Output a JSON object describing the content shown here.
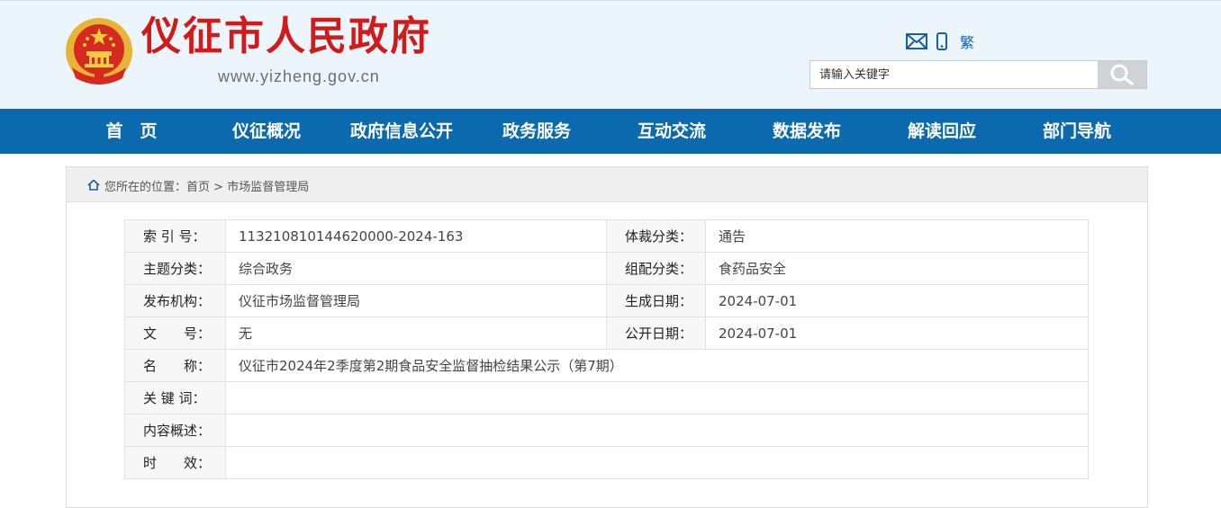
{
  "header": {
    "site_title": "仪征市人民政府",
    "site_url": "www.yizheng.gov.cn",
    "traditional_label": "繁",
    "search_placeholder": "请输入关键字"
  },
  "nav": {
    "items": [
      "首　页",
      "仪征概况",
      "政府信息公开",
      "政务服务",
      "互动交流",
      "数据发布",
      "解读回应",
      "部门导航"
    ]
  },
  "breadcrumb": {
    "prefix": "您所在的位置：",
    "home": "首页",
    "sep": " > ",
    "current": "市场监督管理局"
  },
  "meta": {
    "index_label": "索 引 号：",
    "index_value": "113210810144620000-2024-163",
    "genre_label": "体裁分类：",
    "genre_value": "通告",
    "topic_label": "主题分类：",
    "topic_value": "综合政务",
    "org_class_label": "组配分类：",
    "org_class_value": "食药品安全",
    "publisher_label": "发布机构：",
    "publisher_value": "仪征市场监督管理局",
    "created_label": "生成日期：",
    "created_value": "2024-07-01",
    "docno_label": "文　　号：",
    "docno_value": "无",
    "published_label": "公开日期：",
    "published_value": "2024-07-01",
    "name_label": "名　　称：",
    "name_value": "仪征市2024年2季度第2期食品安全监督抽检结果公示（第7期）",
    "keywords_label": "关 键 词：",
    "keywords_value": "",
    "summary_label": "内容概述：",
    "summary_value": "",
    "validity_label": "时　　效：",
    "validity_value": ""
  },
  "colors": {
    "title_red": "#d11a1a",
    "nav_blue": "#0a6aad",
    "header_bg": "#edf5fc"
  }
}
